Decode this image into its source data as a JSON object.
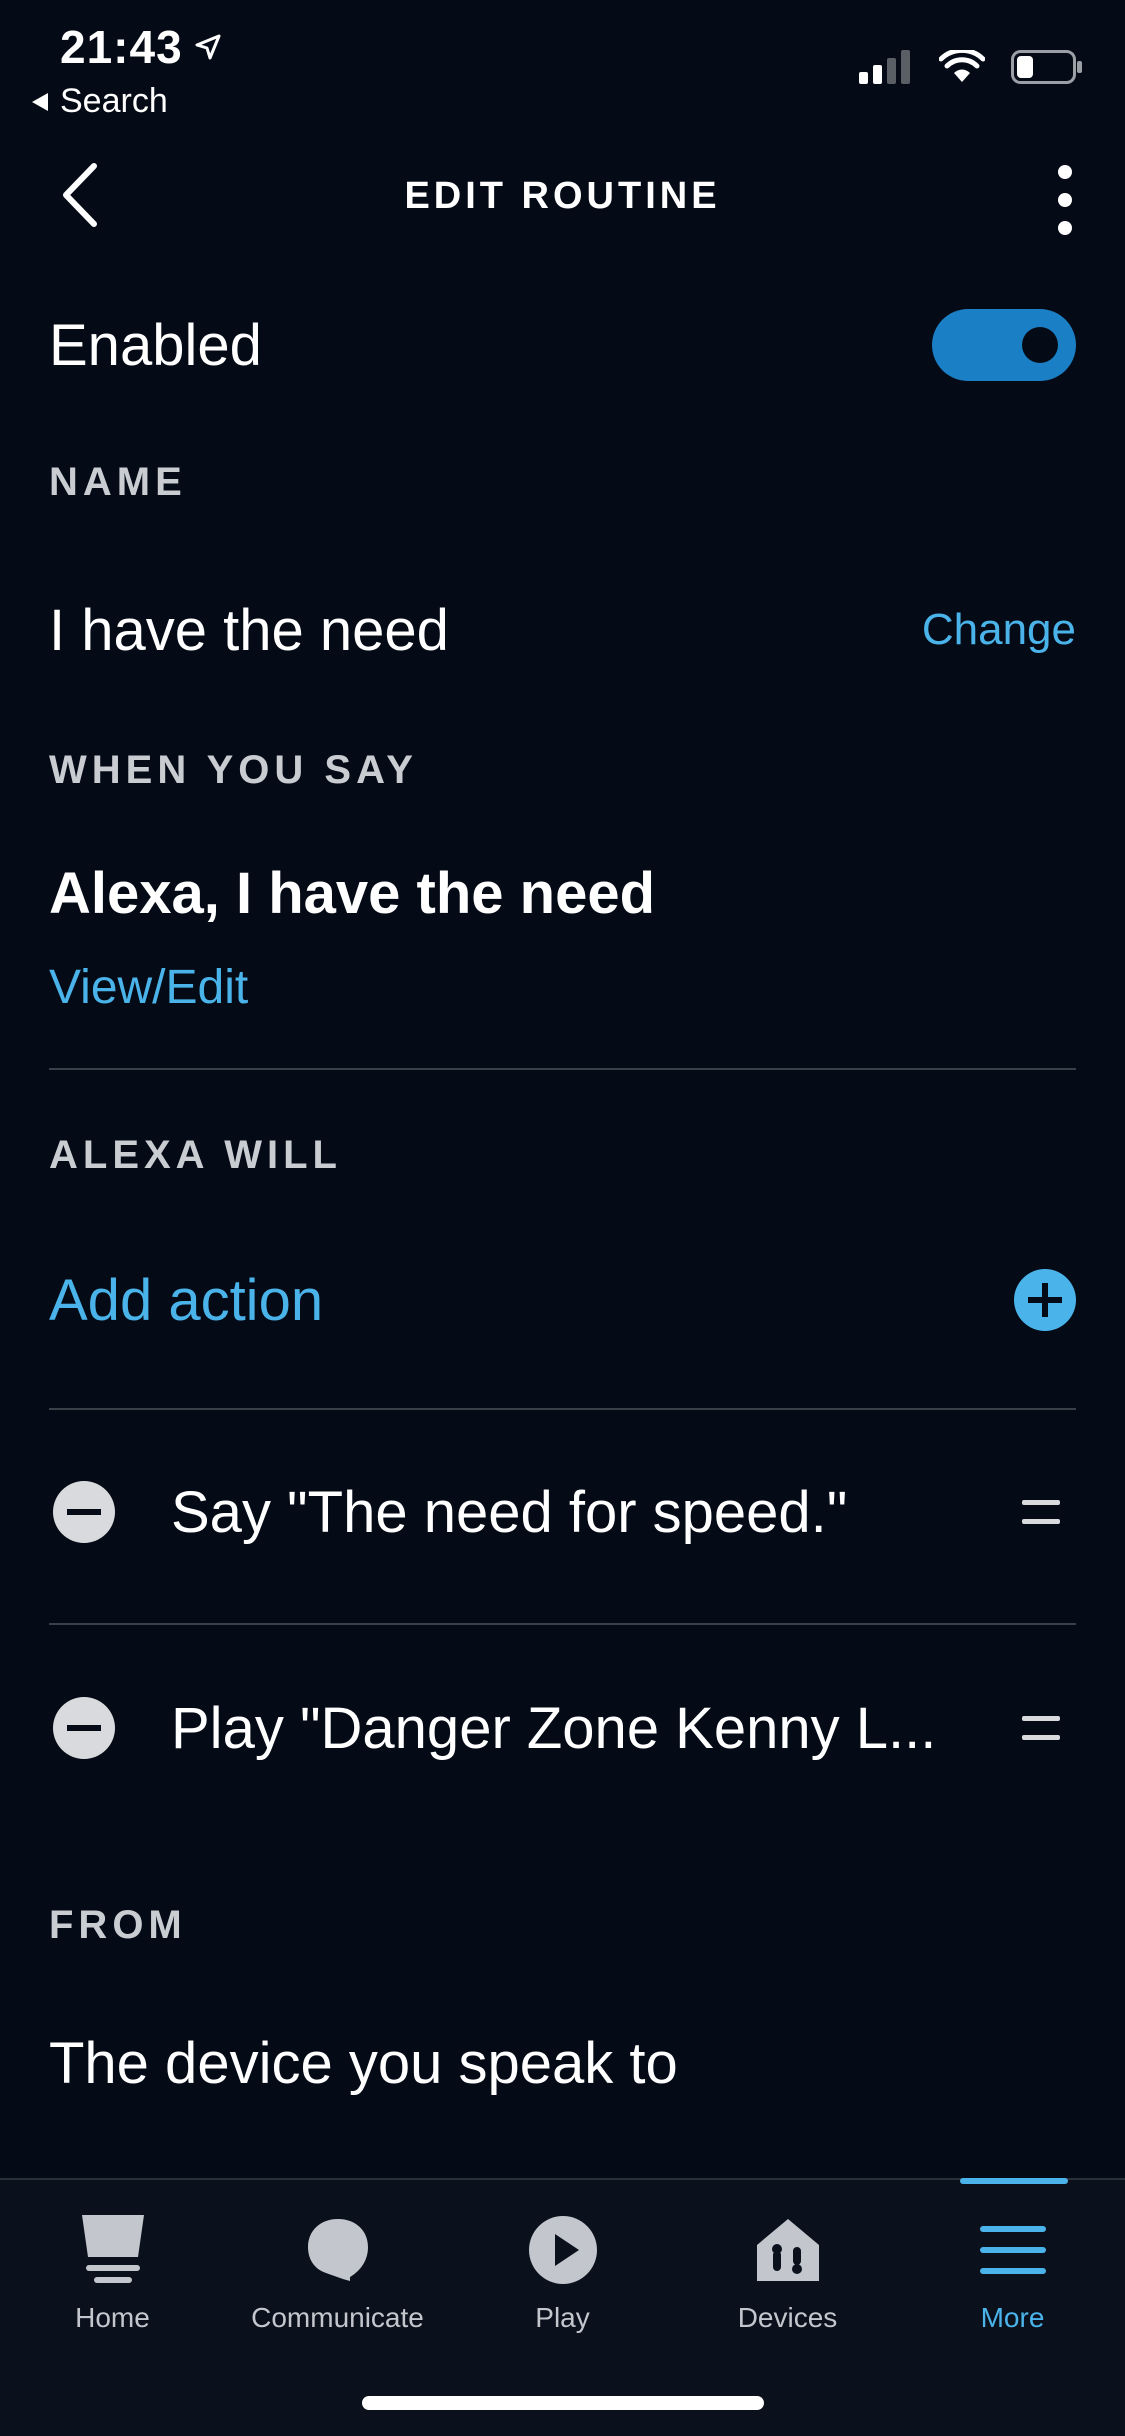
{
  "status": {
    "time": "21:43",
    "back_label": "Search"
  },
  "header": {
    "title": "EDIT ROUTINE"
  },
  "enabled": {
    "label": "Enabled",
    "on": true
  },
  "name_section": {
    "label": "NAME",
    "value": "I have the need",
    "change": "Change"
  },
  "say_section": {
    "label": "WHEN YOU SAY",
    "phrase": "Alexa, I have the need",
    "view_edit": "View/Edit"
  },
  "will_section": {
    "label": "ALEXA WILL",
    "add_action": "Add action",
    "actions": [
      {
        "text": "Say \"The need for speed.\""
      },
      {
        "text": "Play \"Danger Zone Kenny L..."
      }
    ]
  },
  "from_section": {
    "label": "FROM",
    "value": "The device you speak to"
  },
  "tabbar": {
    "items": [
      {
        "label": "Home",
        "icon": "home-icon"
      },
      {
        "label": "Communicate",
        "icon": "chat-bubble-icon"
      },
      {
        "label": "Play",
        "icon": "play-icon"
      },
      {
        "label": "Devices",
        "icon": "devices-icon"
      },
      {
        "label": "More",
        "icon": "hamburger-menu-icon",
        "active": true
      }
    ]
  },
  "colors": {
    "background": "#050b16",
    "accent": "#4ab3ea",
    "toggle_on": "#1a7fc4"
  }
}
